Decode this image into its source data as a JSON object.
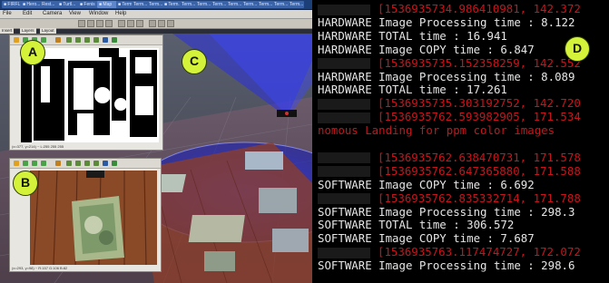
{
  "taskbar": {
    "items": [
      "■ FIRFL",
      "■ Hero...",
      "Rest...",
      "■ Turtl...",
      "■ Fenis",
      "■ Map",
      "■ Term...",
      "Term...",
      "Term...",
      "■ Term...",
      "Term...",
      "Term...",
      "Term...",
      "Term...",
      "Term...",
      "Term...",
      "Term...",
      "Term..."
    ]
  },
  "menu": {
    "items": [
      "File",
      "Edit",
      "Camera",
      "View",
      "Window",
      "Help"
    ]
  },
  "tabs": [
    "Insert",
    "Layers",
    "Layout"
  ],
  "window_a": {
    "label": "A",
    "status": "(x=377, y=214) ~ L:255 255 255"
  },
  "window_b": {
    "label": "B",
    "status": "(x=293, y=98) ~ R:157 G:106 B:82"
  },
  "scene": {
    "label": "C"
  },
  "terminal": {
    "label": "D",
    "lines": [
      {
        "text": "[1536935734.986410981, 142.372",
        "color": "red",
        "block": true
      },
      {
        "text": "HARDWARE Image Processing time : 8.122",
        "color": "white"
      },
      {
        "text": "HARDWARE TOTAL time : 16.941",
        "color": "white"
      },
      {
        "text": "HARDWARE Image COPY time : 6.847",
        "color": "white"
      },
      {
        "text": "[1536935735.152358259, 142.552",
        "color": "red",
        "block": true
      },
      {
        "text": "HARDWARE Image Processing time : 8.089",
        "color": "white"
      },
      {
        "text": "HARDWARE TOTAL time : 17.261",
        "color": "white"
      },
      {
        "text": "[1536935735.303192752, 142.720",
        "color": "red",
        "block": true
      },
      {
        "text": "[1536935762.593982905, 171.534",
        "color": "red",
        "block": true
      },
      {
        "text": "nomous Landing for ppm color images",
        "color": "red"
      },
      {
        "text": "",
        "color": "white"
      },
      {
        "text": "[1536935762.638470731, 171.578",
        "color": "red",
        "block": true
      },
      {
        "text": "[1536935762.647365880, 171.588",
        "color": "red",
        "block": true
      },
      {
        "text": "SOFTWARE Image COPY time : 6.692",
        "color": "white"
      },
      {
        "text": "[1536935762.835332714, 171.788",
        "color": "red",
        "block": true
      },
      {
        "text": "SOFTWARE Image Processing time : 298.3",
        "color": "white"
      },
      {
        "text": "SOFTWARE TOTAL time : 306.572",
        "color": "white"
      },
      {
        "text": "SOFTWARE Image COPY time : 7.687",
        "color": "white"
      },
      {
        "text": "[1536935763.117474727, 172.072",
        "color": "red",
        "block": true
      },
      {
        "text": "SOFTWARE Image Processing time : 298.6",
        "color": "white"
      }
    ]
  },
  "colors": {
    "label_bg": "#d4f23a",
    "terminal_red": "#c8151b",
    "terminal_white": "#e6e6e6"
  }
}
